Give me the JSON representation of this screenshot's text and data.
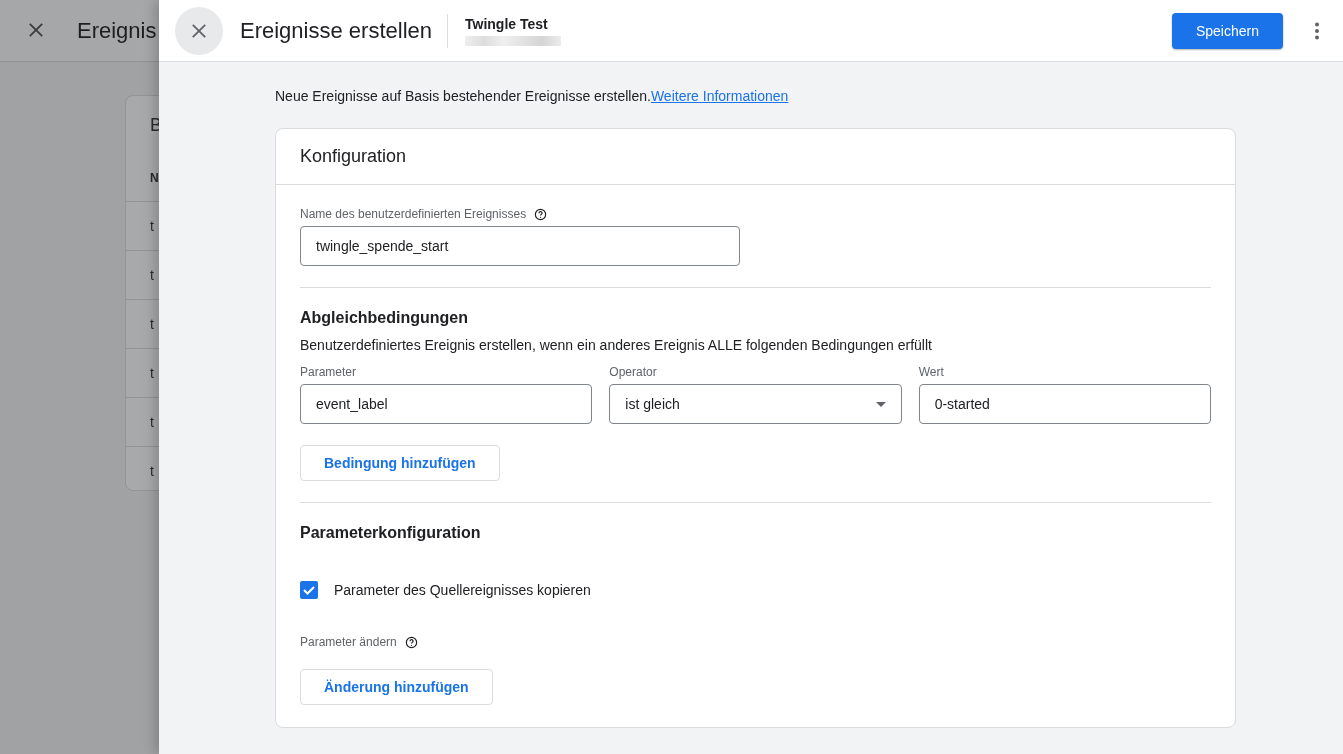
{
  "background_page": {
    "title": "Ereignis",
    "card_title": "B",
    "column_1": "N",
    "rows": [
      "t",
      "t",
      "t",
      "t",
      "t",
      "t"
    ]
  },
  "drawer": {
    "title": "Ereignisse erstellen",
    "property": "Twingle Test",
    "save_button": "Speichern"
  },
  "intro": {
    "text": "Neue Ereignisse auf Basis bestehender Ereignisse erstellen.",
    "link": "Weitere Informationen"
  },
  "card": {
    "title": "Konfiguration",
    "name_field": {
      "label": "Name des benutzerdefinierten Ereignisses",
      "value": "twingle_spende_start"
    },
    "conditions": {
      "heading": "Abgleichbedingungen",
      "description": "Benutzerdefiniertes Ereignis erstellen, wenn ein anderes Ereignis ALLE folgenden Bedingungen erfüllt",
      "fields": [
        {
          "kind": "text",
          "label": "Parameter",
          "value": "event_label"
        },
        {
          "kind": "dropdown",
          "label": "Operator",
          "value": "ist gleich"
        },
        {
          "kind": "text",
          "label": "Wert",
          "value": "0-started"
        }
      ],
      "add_button": "Bedingung hinzufügen"
    },
    "parameters": {
      "heading": "Parameterkonfiguration",
      "copy_checkbox": {
        "label": "Parameter des Quellereignisses kopieren",
        "checked": true
      },
      "modify_label": "Parameter ändern",
      "add_button": "Änderung hinzufügen"
    }
  }
}
